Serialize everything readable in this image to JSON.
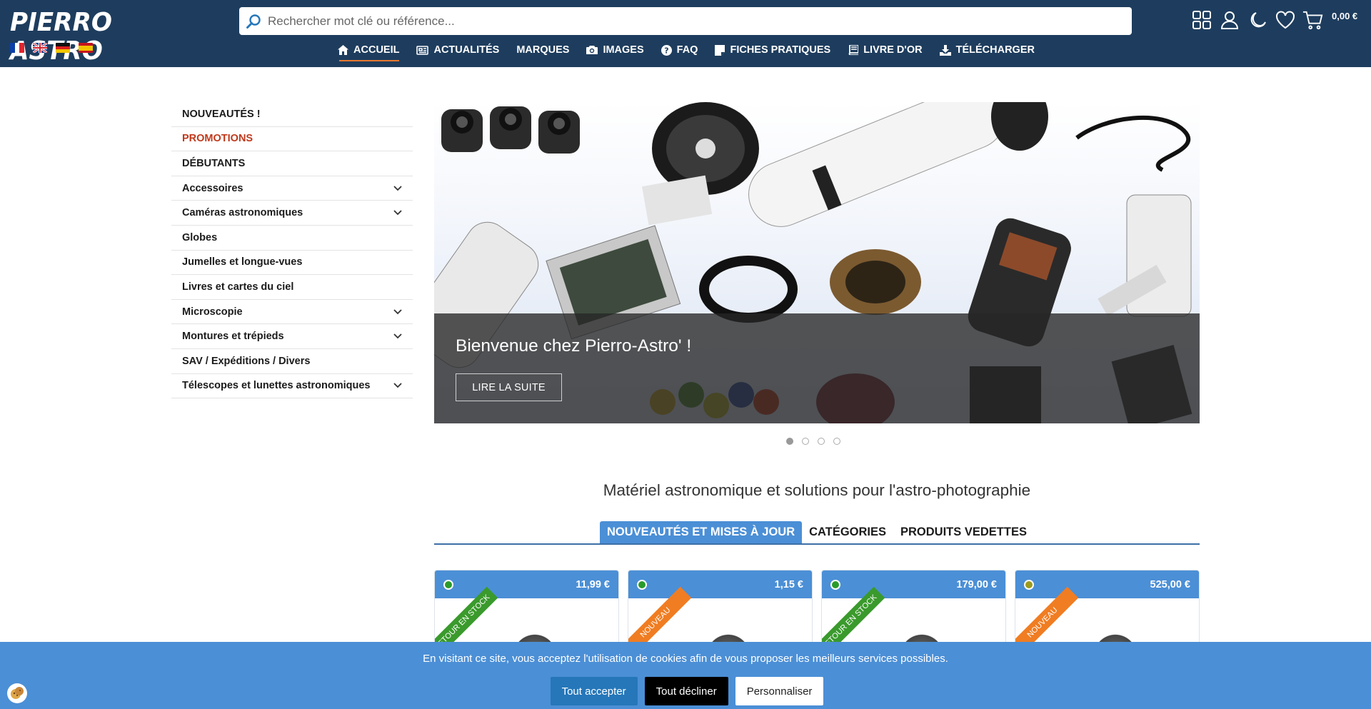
{
  "header": {
    "logo_text": "PIERRO ASTRO",
    "search_placeholder": "Rechercher mot clé ou référence...",
    "cart_total": "0,00 €",
    "flags": [
      "fr",
      "en",
      "de",
      "es"
    ]
  },
  "nav": {
    "items": [
      {
        "label": "ACCUEIL",
        "icon": "home-icon"
      },
      {
        "label": "ACTUALITÉS",
        "icon": "newspaper-icon"
      },
      {
        "label": "MARQUES",
        "icon": ""
      },
      {
        "label": "IMAGES",
        "icon": "camera-icon"
      },
      {
        "label": "FAQ",
        "icon": "question-icon"
      },
      {
        "label": "FICHES PRATIQUES",
        "icon": "note-icon"
      },
      {
        "label": "LIVRE D'OR",
        "icon": "book-icon"
      },
      {
        "label": "TÉLÉCHARGER",
        "icon": "download-icon"
      }
    ]
  },
  "sidebar": {
    "items": [
      {
        "label": "NOUVEAUTÉS !",
        "has_children": false
      },
      {
        "label": "PROMOTIONS",
        "has_children": false
      },
      {
        "label": "DÉBUTANTS",
        "has_children": false
      },
      {
        "label": "Accessoires",
        "has_children": true
      },
      {
        "label": "Caméras astronomiques",
        "has_children": true
      },
      {
        "label": "Globes",
        "has_children": false
      },
      {
        "label": "Jumelles et longue-vues",
        "has_children": false
      },
      {
        "label": "Livres et cartes du ciel",
        "has_children": false
      },
      {
        "label": "Microscopie",
        "has_children": true
      },
      {
        "label": "Montures et trépieds",
        "has_children": true
      },
      {
        "label": "SAV / Expéditions / Divers",
        "has_children": false
      },
      {
        "label": "Télescopes et lunettes astronomiques",
        "has_children": true
      }
    ]
  },
  "hero": {
    "title": "Bienvenue chez Pierro-Astro' !",
    "button": "LIRE LA SUITE",
    "slides": 4,
    "active_slide": 1
  },
  "main": {
    "tagline": "Matériel astronomique et solutions pour l'astro-photographie",
    "tabs": [
      {
        "label": "NOUVEAUTÉS ET MISES À JOUR",
        "active": true
      },
      {
        "label": "CATÉGORIES",
        "active": false
      },
      {
        "label": "PRODUITS VEDETTES",
        "active": false
      }
    ],
    "products": [
      {
        "price": "11,99 €",
        "stock_color": "#2a9b2a",
        "ribbon": "RETOUR EN STOCK",
        "ribbon_color": "#3a9a2c"
      },
      {
        "price": "1,15 €",
        "stock_color": "#2a9b2a",
        "ribbon": "NOUVEAU",
        "ribbon_color": "#f07d22"
      },
      {
        "price": "179,00 €",
        "stock_color": "#2a9b2a",
        "ribbon": "RETOUR EN STOCK",
        "ribbon_color": "#3a9a2c"
      },
      {
        "price": "525,00 €",
        "stock_color": "#9b9b1e",
        "ribbon": "NOUVEAU",
        "ribbon_color": "#f07d22"
      }
    ]
  },
  "cookie": {
    "text": "En visitant ce site, vous acceptez l'utilisation de cookies afin de vous proposer les meilleurs services possibles.",
    "accept": "Tout accepter",
    "decline": "Tout décliner",
    "customize": "Personnaliser"
  },
  "colors": {
    "header_bg": "#1e3d5e",
    "accent_blue": "#4b8fd6",
    "promo_red": "#c0391b",
    "nav_underline": "#e8772e"
  }
}
